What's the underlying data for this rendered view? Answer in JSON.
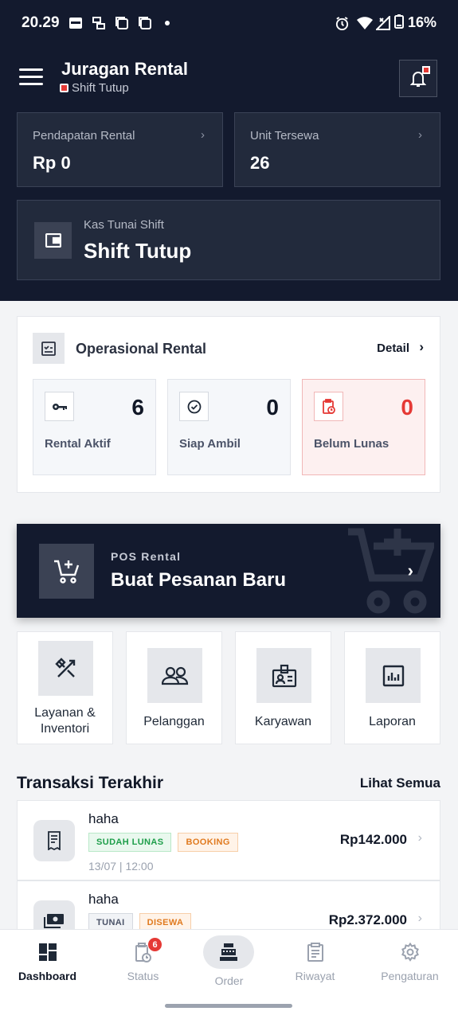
{
  "status_bar": {
    "time": "20.29",
    "battery": "16%"
  },
  "header": {
    "title": "Juragan Rental",
    "shift_status": "Shift Tutup"
  },
  "stats": [
    {
      "label": "Pendapatan Rental",
      "value": "Rp 0"
    },
    {
      "label": "Unit Tersewa",
      "value": "26"
    }
  ],
  "kas": {
    "label": "Kas Tunai Shift",
    "value": "Shift Tutup"
  },
  "operasional": {
    "title": "Operasional Rental",
    "detail_label": "Detail",
    "items": [
      {
        "label": "Rental Aktif",
        "count": "6",
        "icon": "key-icon"
      },
      {
        "label": "Siap Ambil",
        "count": "0",
        "icon": "check-circle-icon"
      },
      {
        "label": "Belum Lunas",
        "count": "0",
        "icon": "clipboard-clock-icon"
      }
    ]
  },
  "pos": {
    "label": "POS Rental",
    "title": "Buat Pesanan Baru"
  },
  "quick_menu": [
    {
      "label": "Layanan & Inventori",
      "icon": "tools-icon"
    },
    {
      "label": "Pelanggan",
      "icon": "users-icon"
    },
    {
      "label": "Karyawan",
      "icon": "id-badge-icon"
    },
    {
      "label": "Laporan",
      "icon": "bar-chart-icon"
    }
  ],
  "transactions": {
    "title": "Transaksi Terakhir",
    "see_all": "Lihat Semua",
    "items": [
      {
        "name": "haha",
        "badges": [
          "SUDAH LUNAS",
          "BOOKING"
        ],
        "date": "13/07 | 12:00",
        "amount": "Rp142.000"
      },
      {
        "name": "haha",
        "badges": [
          "TUNAI",
          "DISEWA"
        ],
        "date": "",
        "amount": "Rp2.372.000"
      }
    ]
  },
  "nav": {
    "items": [
      {
        "label": "Dashboard"
      },
      {
        "label": "Status",
        "badge": "6"
      },
      {
        "label": "Order"
      },
      {
        "label": "Riwayat"
      },
      {
        "label": "Pengaturan"
      }
    ]
  },
  "colors": {
    "primary": "#131a2e",
    "danger": "#e53935",
    "success": "#1e9e4a",
    "warning": "#e07a1f"
  }
}
